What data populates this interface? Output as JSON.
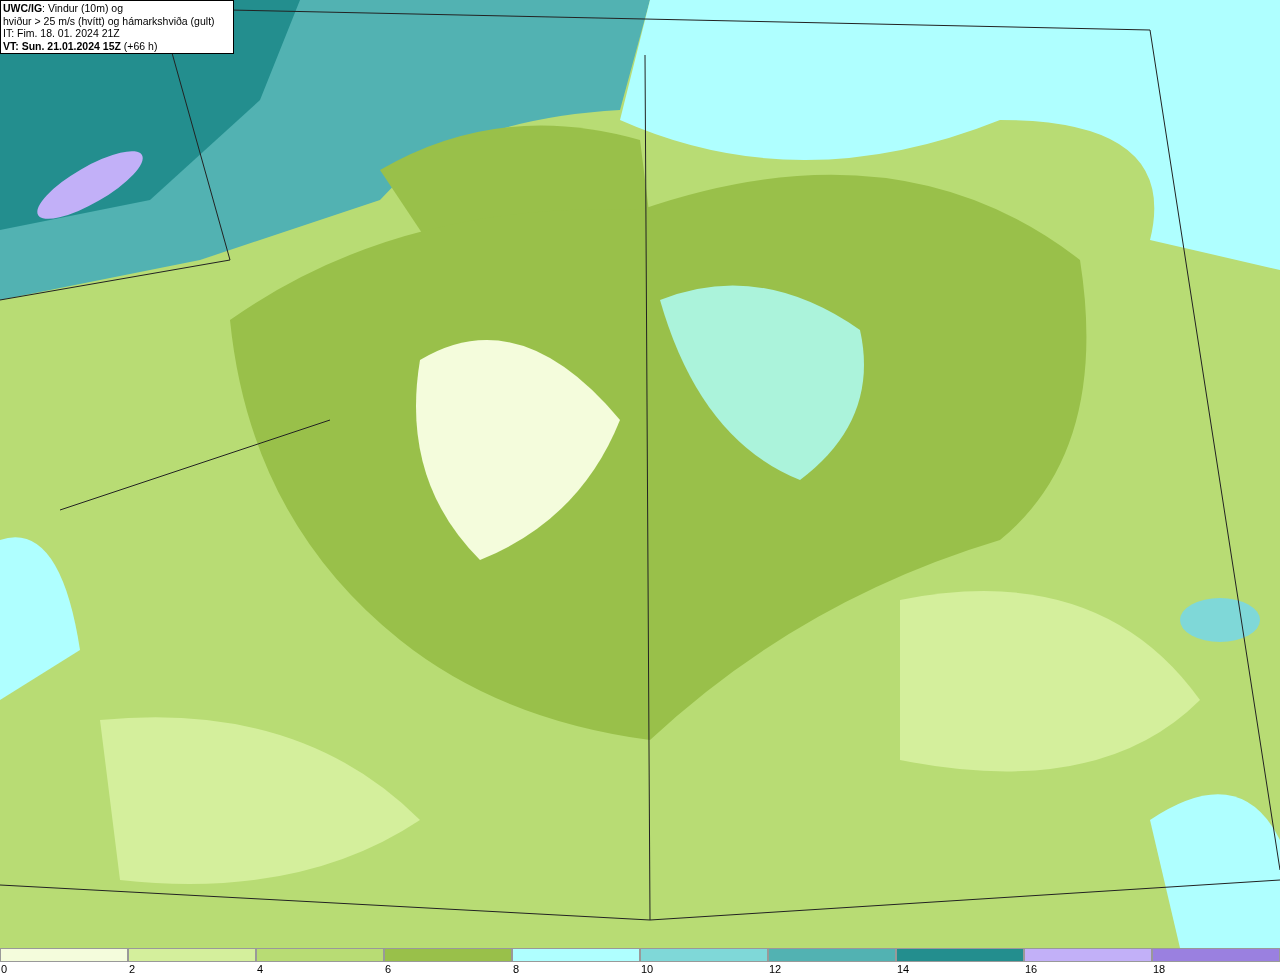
{
  "info_box": {
    "lines": [
      "**UWC/IG**: Vindur (10m) og",
      "hviður > 25 m/s (hvítt) og hámarkshviða (gult)",
      "IT: Fim. 18. 01. 2024 21Z",
      "**VT: Sun. 21.01.2024 15Z** (+66 h)"
    ]
  },
  "legend": [
    {
      "label": "0",
      "color": "#f4fcdc"
    },
    {
      "label": "2",
      "color": "#d4ef9c"
    },
    {
      "label": "4",
      "color": "#b8dc74"
    },
    {
      "label": "6",
      "color": "#99c04a"
    },
    {
      "label": "8",
      "color": "#afffff"
    },
    {
      "label": "10",
      "color": "#7fd8d8"
    },
    {
      "label": "12",
      "color": "#52b2b2"
    },
    {
      "label": "14",
      "color": "#238e8e"
    },
    {
      "label": "16",
      "color": "#c2b0f8"
    },
    {
      "label": "18",
      "color": "#9a80e0"
    }
  ]
}
